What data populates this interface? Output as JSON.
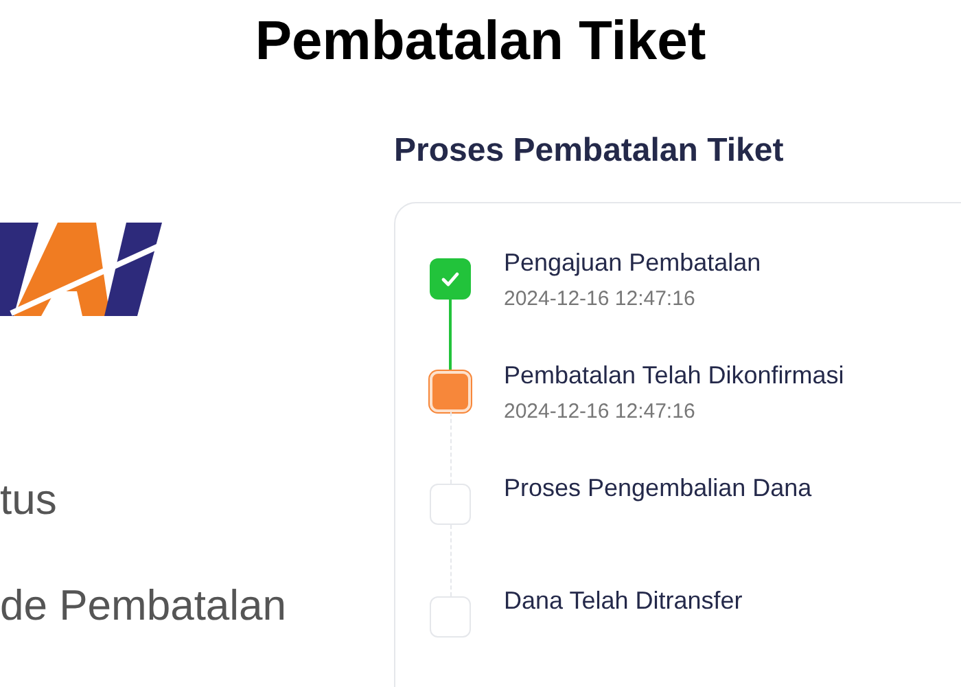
{
  "title": "Pembatalan Tiket",
  "left_labels": [
    "tus",
    "de Pembatalan"
  ],
  "process": {
    "heading": "Proses Pembatalan Tiket",
    "steps": [
      {
        "label": "Pengajuan Pembatalan",
        "time": "2024-12-16 12:47:16",
        "kind": "done"
      },
      {
        "label": "Pembatalan Telah Dikonfirmasi",
        "time": "2024-12-16 12:47:16",
        "kind": "current"
      },
      {
        "label": "Proses Pengembalian Dana",
        "kind": "pending"
      },
      {
        "label": "Dana Telah Ditransfer",
        "kind": "pending"
      }
    ]
  }
}
